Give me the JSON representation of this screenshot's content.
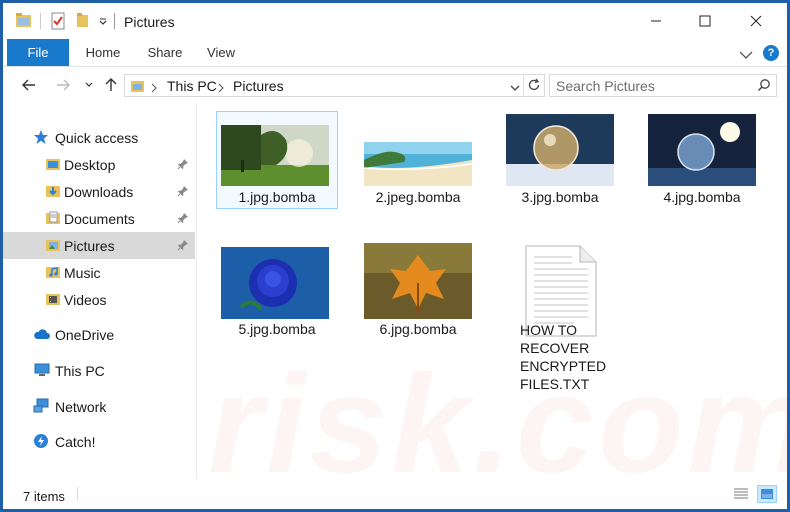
{
  "window": {
    "title": "Pictures"
  },
  "ribbon": {
    "tabs": [
      "File",
      "Home",
      "Share",
      "View"
    ],
    "help_icon": "?"
  },
  "address": {
    "crumbs": [
      "This PC",
      "Pictures"
    ],
    "search_placeholder": "Search Pictures"
  },
  "nav": {
    "items": [
      {
        "label": "Quick access",
        "icon": "star-icon"
      },
      {
        "label": "Desktop",
        "icon": "folder-icon",
        "pinned": true
      },
      {
        "label": "Downloads",
        "icon": "download-folder-icon",
        "pinned": true
      },
      {
        "label": "Documents",
        "icon": "documents-folder-icon",
        "pinned": true
      },
      {
        "label": "Pictures",
        "icon": "pictures-folder-icon",
        "pinned": true,
        "selected": true
      },
      {
        "label": "Music",
        "icon": "music-folder-icon"
      },
      {
        "label": "Videos",
        "icon": "videos-folder-icon"
      },
      {
        "label": "OneDrive",
        "icon": "cloud-icon"
      },
      {
        "label": "This PC",
        "icon": "computer-icon"
      },
      {
        "label": "Network",
        "icon": "network-icon"
      },
      {
        "label": "Catch!",
        "icon": "catch-icon"
      }
    ]
  },
  "files": [
    {
      "name": "1.jpg.bomba",
      "kind": "image",
      "selected": true
    },
    {
      "name": "2.jpeg.bomba",
      "kind": "image"
    },
    {
      "name": "3.jpg.bomba",
      "kind": "image"
    },
    {
      "name": "4.jpg.bomba",
      "kind": "image"
    },
    {
      "name": "5.jpg.bomba",
      "kind": "image"
    },
    {
      "name": "6.jpg.bomba",
      "kind": "image"
    },
    {
      "name": "HOW TO RECOVER ENCRYPTED FILES.TXT",
      "kind": "text",
      "lines": [
        "HOW TO",
        "RECOVER",
        "ENCRYPTED",
        "FILES.TXT"
      ]
    }
  ],
  "status": {
    "item_count": "7 items"
  },
  "watermark": "risk.com",
  "colors": {
    "accent": "#1979ca",
    "selection": "#d9d9d9",
    "file_selection_border": "#99d1ff"
  }
}
